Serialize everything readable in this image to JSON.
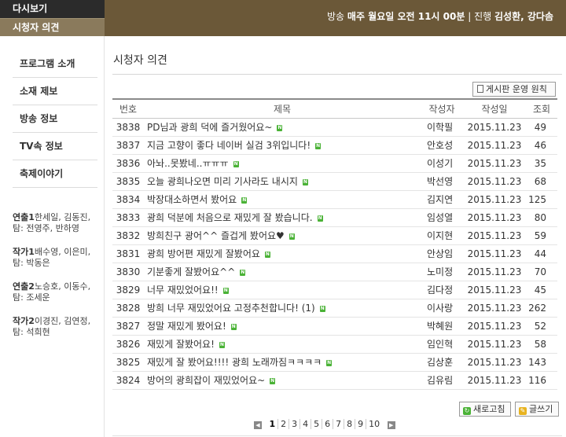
{
  "header": {
    "rewatch_label": "다시보기",
    "viewer_label": "시청자 의견",
    "broadcast_prefix": "방송",
    "broadcast_time": "매주 월요일 오전 11시 00분",
    "separator": "|",
    "host_prefix": "진행",
    "hosts": "김성환, 강다솜"
  },
  "sidebar": {
    "items": [
      {
        "label": "프로그램 소개"
      },
      {
        "label": "소재 제보"
      },
      {
        "label": "방송 정보"
      },
      {
        "label": "TV속 정보"
      },
      {
        "label": "축제이야기"
      }
    ],
    "credits": [
      {
        "role": "연출1",
        "text": "한세일, 김동진, 탐: 전영주, 반하영"
      },
      {
        "role": "작가1",
        "text": "배수영, 이은미, 탐: 박동은"
      },
      {
        "role": "연출2",
        "text": "노승호, 이동수, 탐: 조세운"
      },
      {
        "role": "작가2",
        "text": "이경진, 김연정, 탐: 석희현"
      }
    ]
  },
  "main": {
    "title": "시청자 의견",
    "policy_button": "게시판 운영 원칙",
    "columns": {
      "num": "번호",
      "subject": "제목",
      "author": "작성자",
      "date": "작성일",
      "views": "조회"
    },
    "new_badge": "N",
    "rows": [
      {
        "num": "3838",
        "subject": "PD님과 광희 덕에 즐거웠어요~",
        "author": "이학필",
        "date": "2015.11.23",
        "views": "49"
      },
      {
        "num": "3837",
        "subject": "지금 고향이 좋다 네이버 실검 3위입니다!",
        "author": "안호성",
        "date": "2015.11.23",
        "views": "46"
      },
      {
        "num": "3836",
        "subject": "아놔..못봤네..ㅠㅠㅠ",
        "author": "이성기",
        "date": "2015.11.23",
        "views": "35"
      },
      {
        "num": "3835",
        "subject": "오늘 광희나오면 미리 기사라도 내시지",
        "author": "박선영",
        "date": "2015.11.23",
        "views": "68"
      },
      {
        "num": "3834",
        "subject": "박장대소하면서 봤어요",
        "author": "김지연",
        "date": "2015.11.23",
        "views": "125"
      },
      {
        "num": "3833",
        "subject": "광희 덕분에 처음으로 재밌게 잘 봤습니다.",
        "author": "임성열",
        "date": "2015.11.23",
        "views": "80"
      },
      {
        "num": "3832",
        "subject": "방희친구 광어^^ 즐겁게 봤어요♥",
        "author": "이지현",
        "date": "2015.11.23",
        "views": "59"
      },
      {
        "num": "3831",
        "subject": "광희 방어편 재밌게 잘봤어요",
        "author": "안상임",
        "date": "2015.11.23",
        "views": "44"
      },
      {
        "num": "3830",
        "subject": "기분좋게 잘봤어요^^",
        "author": "노미정",
        "date": "2015.11.23",
        "views": "70"
      },
      {
        "num": "3829",
        "subject": "너무 재밌었어요!!",
        "author": "김다정",
        "date": "2015.11.23",
        "views": "45"
      },
      {
        "num": "3828",
        "subject": "방희 너무 재밌었어요 고정추천합니다! (1)",
        "author": "이사랑",
        "date": "2015.11.23",
        "views": "262"
      },
      {
        "num": "3827",
        "subject": "정말 재밌게 봤어요!",
        "author": "박혜원",
        "date": "2015.11.23",
        "views": "52"
      },
      {
        "num": "3826",
        "subject": "재밌게 잘봤어요!",
        "author": "임인혁",
        "date": "2015.11.23",
        "views": "58"
      },
      {
        "num": "3825",
        "subject": "재밌게 잘 봤어요!!!! 광희 노래까짐ㅋㅋㅋㅋ",
        "author": "김상훈",
        "date": "2015.11.23",
        "views": "143"
      },
      {
        "num": "3824",
        "subject": "방어의 광희잡이 재밌었어요~",
        "author": "김유림",
        "date": "2015.11.23",
        "views": "116"
      }
    ],
    "refresh_button": "새로고침",
    "write_button": "글쓰기",
    "pages": [
      "1",
      "2",
      "3",
      "4",
      "5",
      "6",
      "7",
      "8",
      "9",
      "10"
    ],
    "current_page": "1"
  },
  "colors": {
    "header_brown": "#6b5838",
    "header_dark": "#2b2b2b",
    "header_tan": "#8a7a5c",
    "new_badge_green": "#4ab236"
  }
}
